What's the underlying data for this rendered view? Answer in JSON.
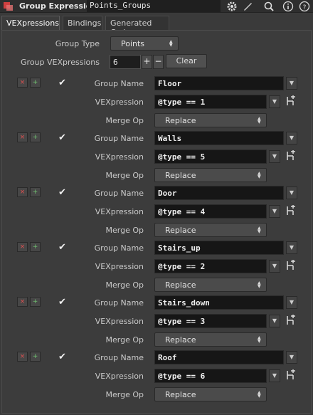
{
  "header": {
    "node_type": "Group Expression",
    "node_name": "Points_Groups",
    "icons": [
      "gear-icon",
      "brush-icon",
      "search-icon",
      "info-icon",
      "help-icon"
    ]
  },
  "tabs": [
    {
      "label": "VEXpressions",
      "active": true
    },
    {
      "label": "Bindings",
      "active": false
    },
    {
      "label": "Generated Code",
      "active": false
    }
  ],
  "group_type": {
    "label": "Group Type",
    "value": "Points"
  },
  "group_vexpressions": {
    "label": "Group VEXpressions",
    "value": "6",
    "plus": "+",
    "minus": "−",
    "clear_label": "Clear"
  },
  "field_labels": {
    "group_name": "Group Name",
    "vexpression": "VEXpression",
    "merge_op": "Merge Op"
  },
  "row_buttons": {
    "remove": "×",
    "insert": "+"
  },
  "checkmark": "✔",
  "groups": [
    {
      "name": "Floor",
      "expr": "@type == 1",
      "merge": "Replace"
    },
    {
      "name": "Walls",
      "expr": "@type == 5",
      "merge": "Replace"
    },
    {
      "name": "Door",
      "expr": "@type == 4",
      "merge": "Replace"
    },
    {
      "name": "Stairs_up",
      "expr": "@type == 2",
      "merge": "Replace"
    },
    {
      "name": "Stairs_down",
      "expr": "@type == 3",
      "merge": "Replace"
    },
    {
      "name": "Roof",
      "expr": "@type == 6",
      "merge": "Replace"
    }
  ],
  "colors": {
    "accent_red": "#e05050",
    "accent_green": "#70c070"
  }
}
